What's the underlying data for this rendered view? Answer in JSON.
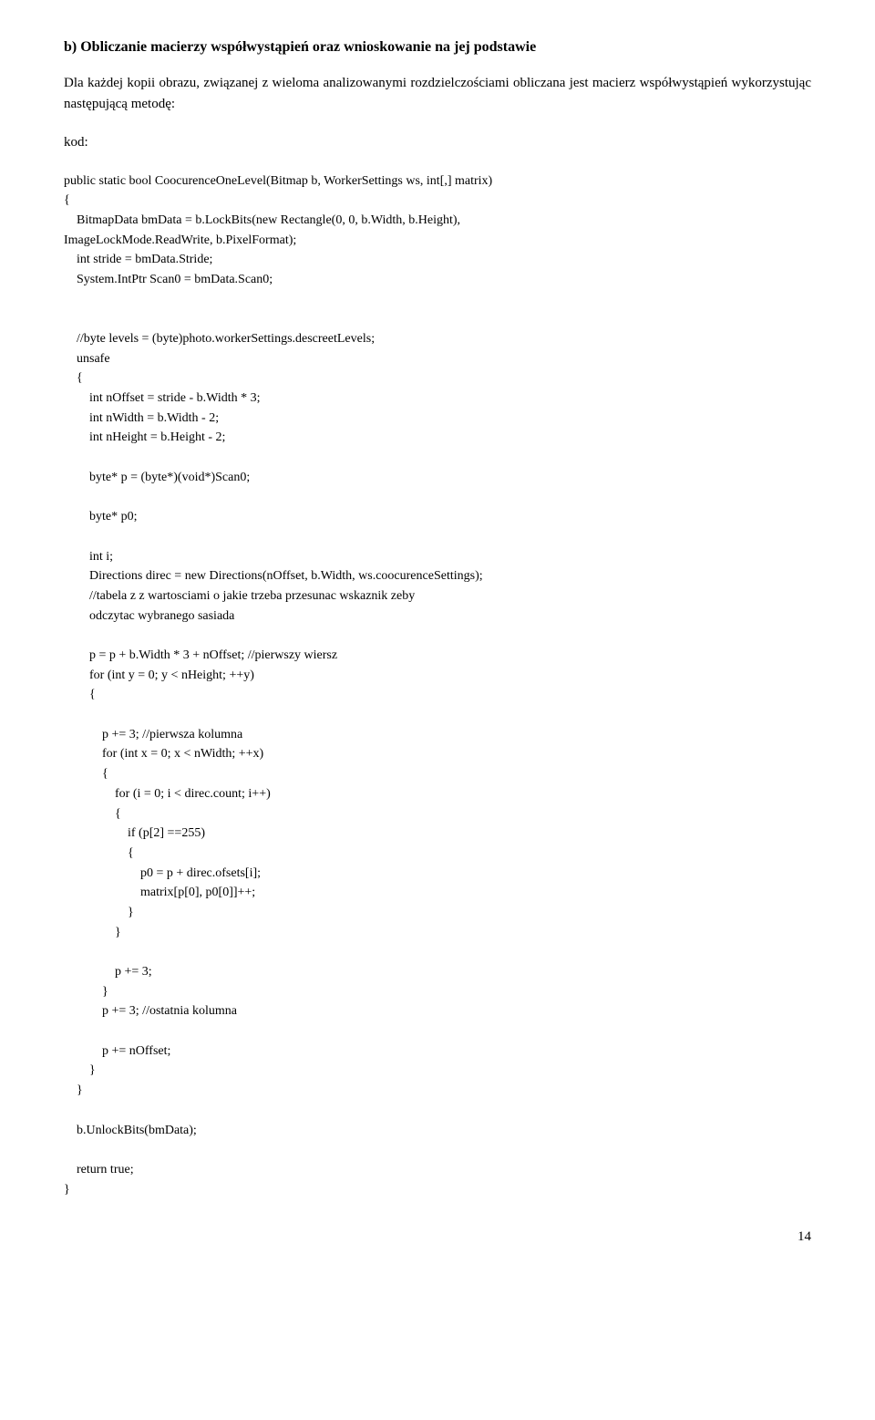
{
  "heading": "b) Obliczanie macierzy współwystąpień oraz wnioskowanie na jej podstawie",
  "paragraph": "Dla każdej kopii obrazu, związanej z wieloma analizowanymi rozdzielczościami obliczana jest macierz współwystąpień wykorzystując następującą metodę:",
  "kod_label": "kod:",
  "code": "public static bool CoocurenceOneLevel(Bitmap b, WorkerSettings ws, int[,] matrix)\n{\n    BitmapData bmData = b.LockBits(new Rectangle(0, 0, b.Width, b.Height),\nImageLockMode.ReadWrite, b.PixelFormat);\n    int stride = bmData.Stride;\n    System.IntPtr Scan0 = bmData.Scan0;\n\n\n    //byte levels = (byte)photo.workerSettings.descreetLevels;\n    unsafe\n    {\n        int nOffset = stride - b.Width * 3;\n        int nWidth = b.Width - 2;\n        int nHeight = b.Height - 2;\n\n        byte* p = (byte*)(void*)Scan0;\n\n        byte* p0;\n\n        int i;\n        Directions direc = new Directions(nOffset, b.Width, ws.coocurenceSettings);\n        //tabela z z wartosciami o jakie trzeba przesunac wskaznik zeby\n        odczytac wybranego sasiada\n\n        p = p + b.Width * 3 + nOffset; //pierwszy wiersz\n        for (int y = 0; y < nHeight; ++y)\n        {\n\n            p += 3; //pierwsza kolumna\n            for (int x = 0; x < nWidth; ++x)\n            {\n                for (i = 0; i < direc.count; i++)\n                {\n                    if (p[2] ==255)\n                    {\n                        p0 = p + direc.ofsets[i];\n                        matrix[p[0], p0[0]]++;\n                    }\n                }\n\n                p += 3;\n            }\n            p += 3; //ostatnia kolumna\n\n            p += nOffset;\n        }\n    }\n\n    b.UnlockBits(bmData);\n\n    return true;\n}",
  "page_number": "14"
}
